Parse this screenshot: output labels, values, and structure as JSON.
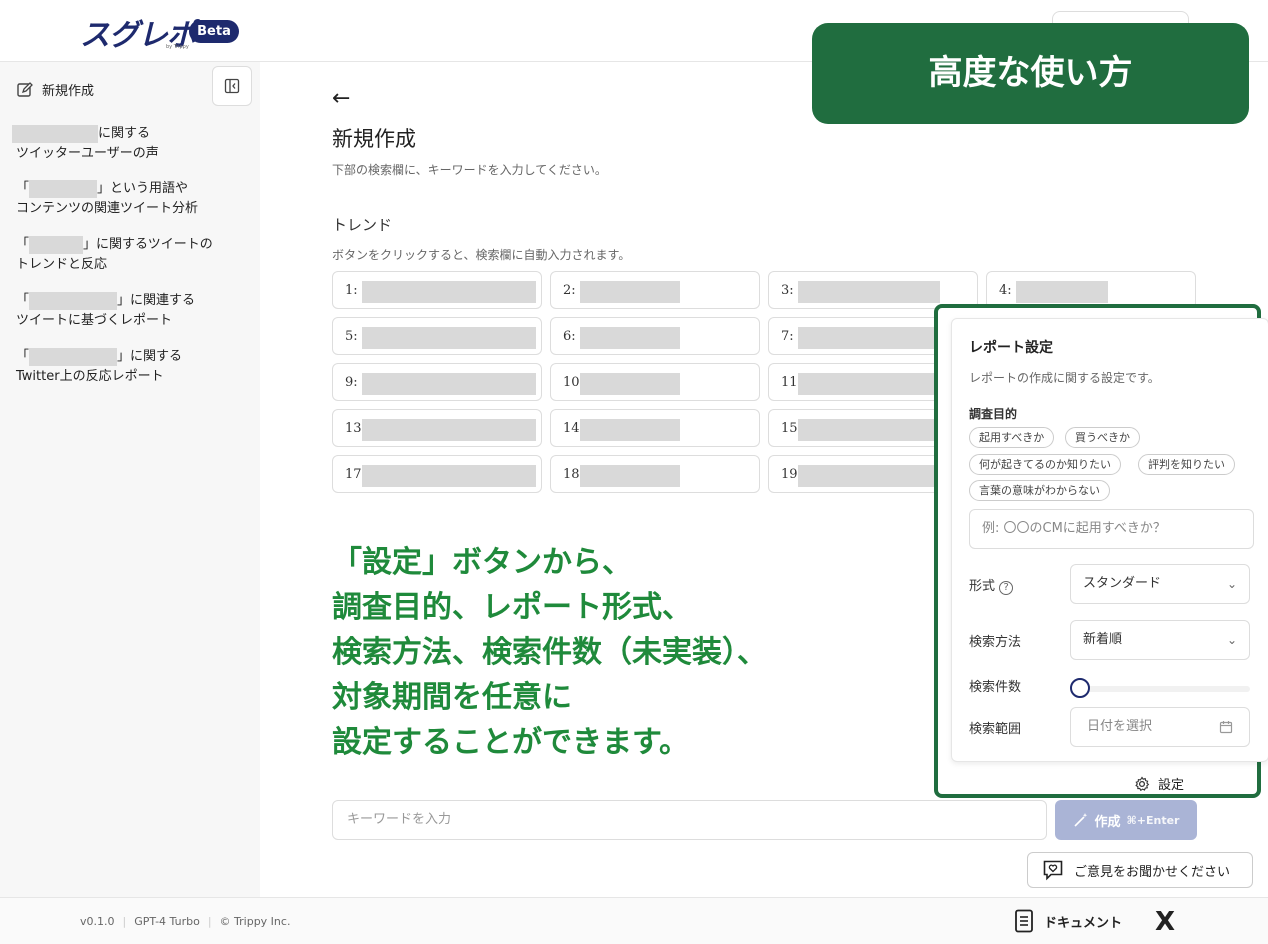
{
  "header": {
    "logo": "スグレポ",
    "logo_sub": "by Trippy",
    "beta": "Beta"
  },
  "sidebar": {
    "new_create": "新規作成",
    "history": [
      {
        "prefix": "",
        "line1": "に関する",
        "line2": "ツイッターユーザーの声"
      },
      {
        "prefix": "「",
        "line1": "」という用語や",
        "line2": "コンテンツの関連ツイート分析"
      },
      {
        "prefix": "「",
        "line1": "」に関するツイートの",
        "line2": "トレンドと反応"
      },
      {
        "prefix": "「",
        "line1": "」に関連する",
        "line2": "ツイートに基づくレポート"
      },
      {
        "prefix": "「",
        "line1": "」に関する",
        "line2": "Twitter上の反応レポート"
      }
    ]
  },
  "main": {
    "back": "←",
    "title": "新規作成",
    "desc": "下部の検索欄に、キーワードを入力してください。",
    "trend_heading": "トレンド",
    "trend_desc": "ボタンをクリックすると、検索欄に自動入力されます。",
    "trends": [
      "1:",
      "2:",
      "3:",
      "4:",
      "5:",
      "6:",
      "7:",
      "9:",
      "10",
      "11",
      "13",
      "14",
      "15",
      "17",
      "18",
      "19"
    ]
  },
  "banner": "高度な使い方",
  "annotation": [
    "「設定」ボタンから、",
    "調査目的、レポート形式、",
    "検索方法、検索件数（未実装）、",
    "対象期間を任意に",
    "設定することができます。"
  ],
  "settings": {
    "title": "レポート設定",
    "desc": "レポートの作成に関する設定です。",
    "purpose_label": "調査目的",
    "chips": [
      "起用すべきか",
      "買うべきか",
      "何が起きてるのか知りたい",
      "評判を知りたい",
      "言葉の意味がわからない"
    ],
    "purpose_placeholder": "例: 〇〇のCMに起用すべきか？",
    "format_label": "形式",
    "format_value": "スタンダード",
    "method_label": "検索方法",
    "method_value": "新着順",
    "count_label": "検索件数",
    "count_value": 0,
    "range_label": "検索範囲",
    "range_placeholder": "日付を選択",
    "settings_button": "設定"
  },
  "input": {
    "placeholder": "キーワードを入力",
    "create": "作成",
    "shortcut": "⌘+Enter"
  },
  "feedback": "ご意見をお聞かせください",
  "footer": {
    "version": "v0.1.0",
    "model": "GPT-4 Turbo",
    "copyright": "© Trippy Inc.",
    "docs": "ドキュメント",
    "x": "X"
  },
  "colors": {
    "brand": "#1e2a6e",
    "accent_green": "#206d3f",
    "annotation_green": "#1f8a3b"
  }
}
